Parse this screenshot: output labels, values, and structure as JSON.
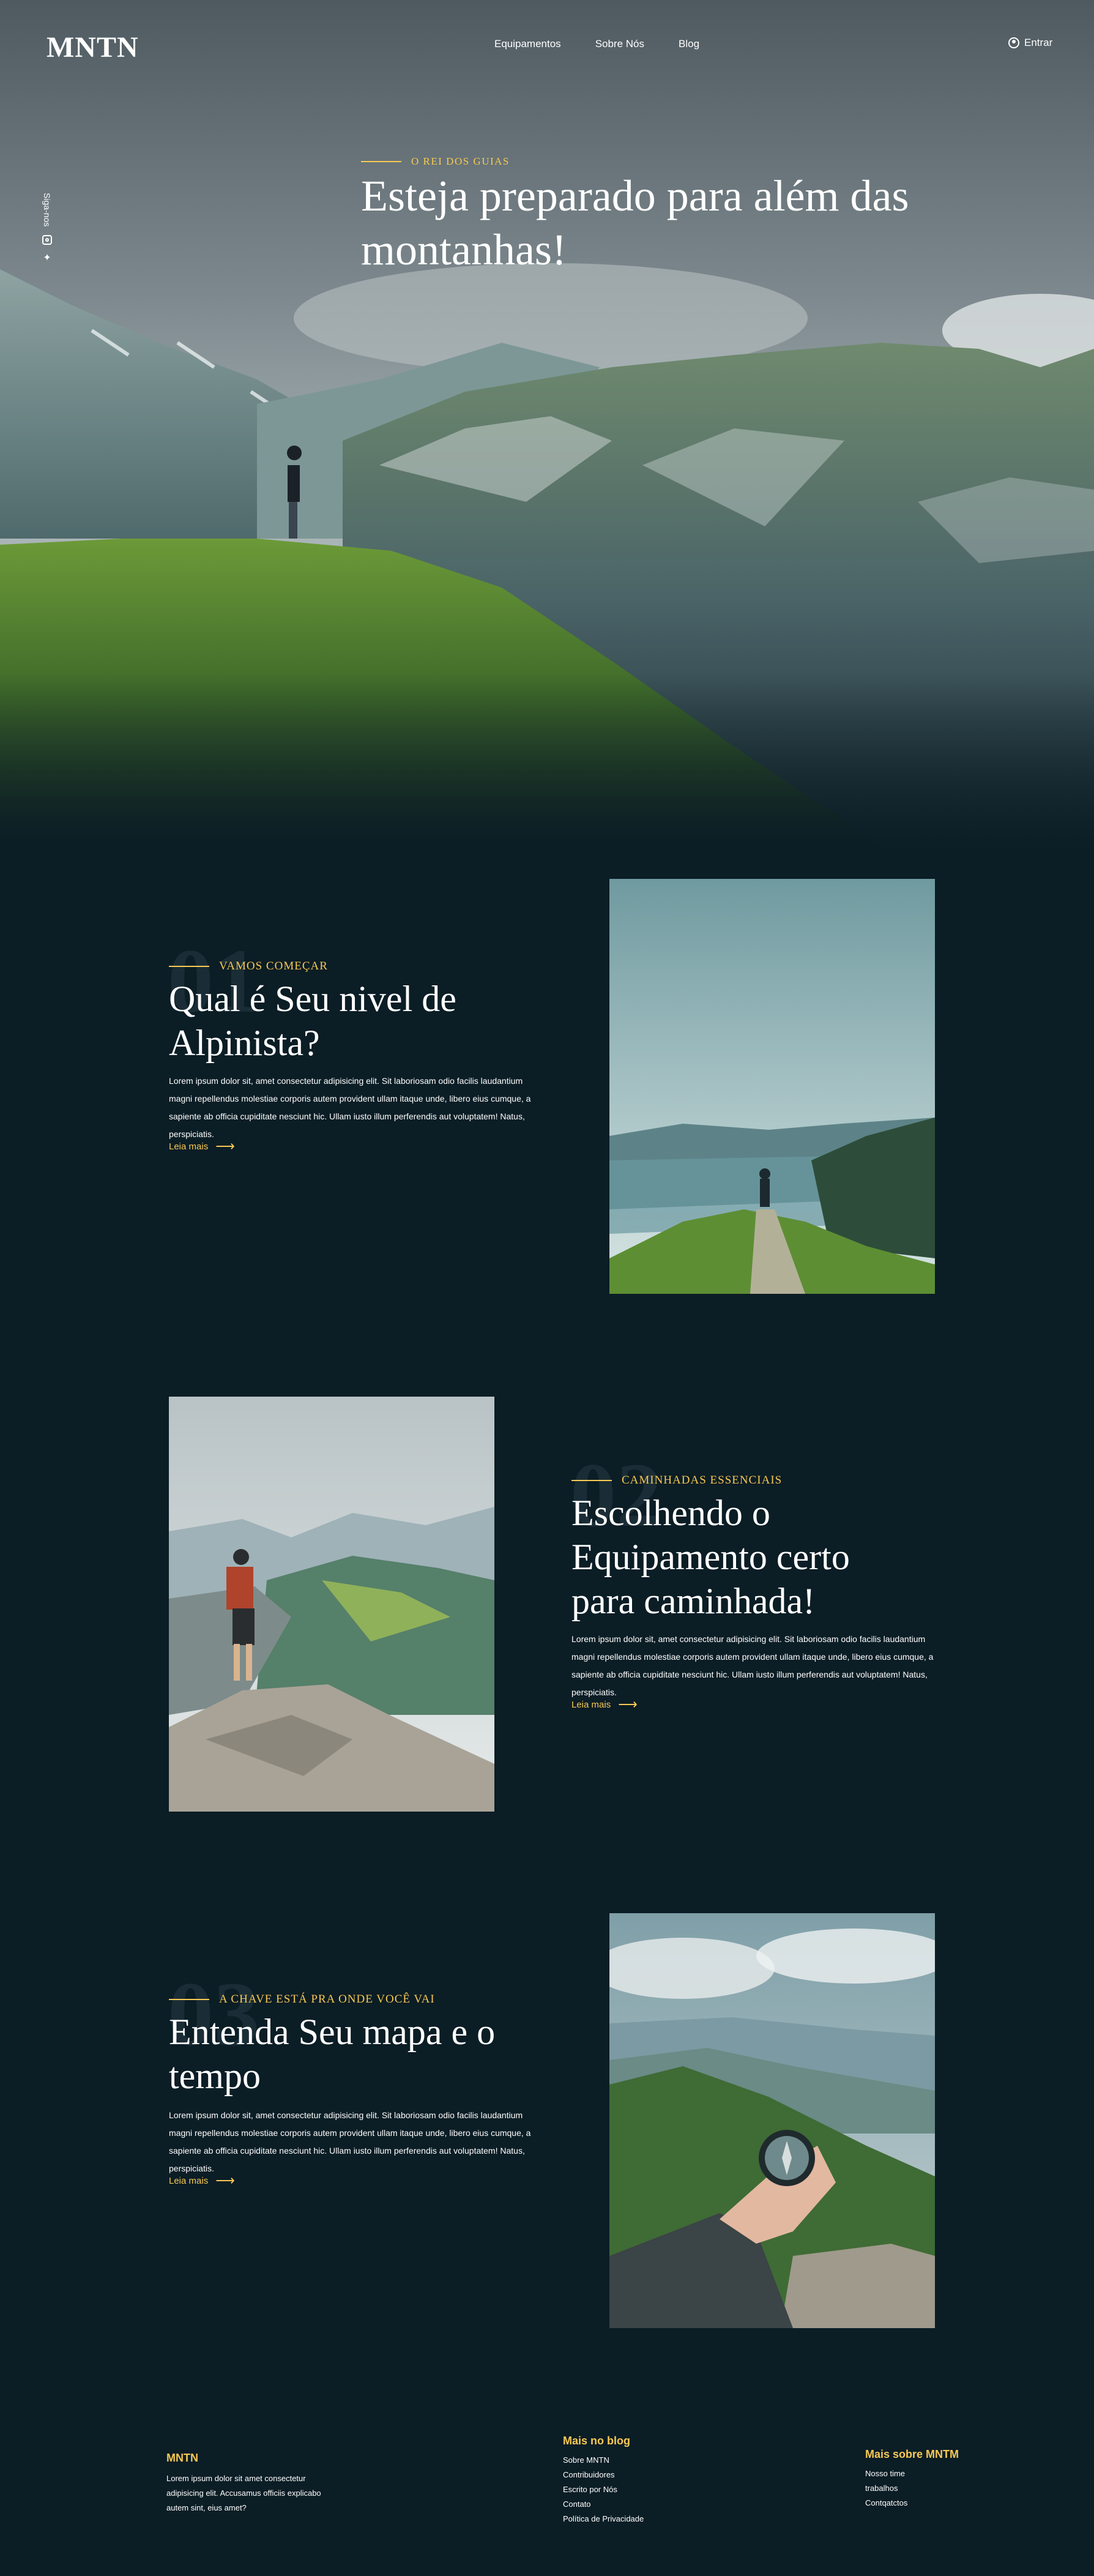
{
  "header": {
    "logo": "MNTN",
    "nav": [
      "Equipamentos",
      "Sobre Nós",
      "Blog"
    ],
    "login_label": "Entrar"
  },
  "social": {
    "follow_label": "Siga-nos",
    "icons": [
      "instagram-icon",
      "twitter-icon"
    ]
  },
  "hero": {
    "eyebrow": "O REI DOS GUIAS",
    "title": "Esteja preparado para além das montanhas!"
  },
  "features": [
    {
      "number": "01",
      "eyebrow": "VAMOS COMEÇAR",
      "title": "Qual é Seu nivel de Alpinista?",
      "body": "Lorem ipsum dolor sit, amet consectetur adipisicing elit. Sit laboriosam odio facilis laudantium magni repellendus molestiae corporis autem provident ullam itaque unde, libero eius cumque, a sapiente ab officia cupiditate nesciunt hic. Ullam iusto illum perferendis aut voluptatem! Natus, perspiciatis.",
      "link": "Leia mais"
    },
    {
      "number": "02",
      "eyebrow": "CAMINHADAS ESSENCIAIS",
      "title": "Escolhendo o Equipamento certo para caminhada!",
      "body": "Lorem ipsum dolor sit, amet consectetur adipisicing elit. Sit laboriosam odio facilis laudantium magni repellendus molestiae corporis autem provident ullam itaque unde, libero eius cumque, a sapiente ab officia cupiditate nesciunt hic. Ullam iusto illum perferendis aut voluptatem! Natus, perspiciatis.",
      "link": "Leia mais"
    },
    {
      "number": "03",
      "eyebrow": "A CHAVE ESTÁ PRA ONDE VOCÊ VAI",
      "title": "Entenda Seu mapa e o tempo",
      "body": "Lorem ipsum dolor sit, amet consectetur adipisicing elit. Sit laboriosam odio facilis laudantium magni repellendus molestiae corporis autem provident ullam itaque unde, libero eius cumque, a sapiente ab officia cupiditate nesciunt hic. Ullam iusto illum perferendis aut voluptatem! Natus, perspiciatis.",
      "link": "Leia mais"
    }
  ],
  "footer": {
    "brand": "MNTN",
    "brand_text": "Lorem ipsum dolor sit amet consectetur adipisicing elit. Accusamus officiis explicabo autem sint, eius amet?",
    "blog_heading": "Mais no blog",
    "blog_links": [
      "Sobre MNTN",
      "Contribuidores",
      "Escrito por Nós",
      "Contato",
      "Política de Privacidade"
    ],
    "more_heading": "Mais sobre MNTM",
    "more_links": [
      "Nosso time",
      "trabalhos",
      "Contqatctos"
    ]
  },
  "colors": {
    "accent": "#f8c953",
    "background": "#0b1d25"
  }
}
